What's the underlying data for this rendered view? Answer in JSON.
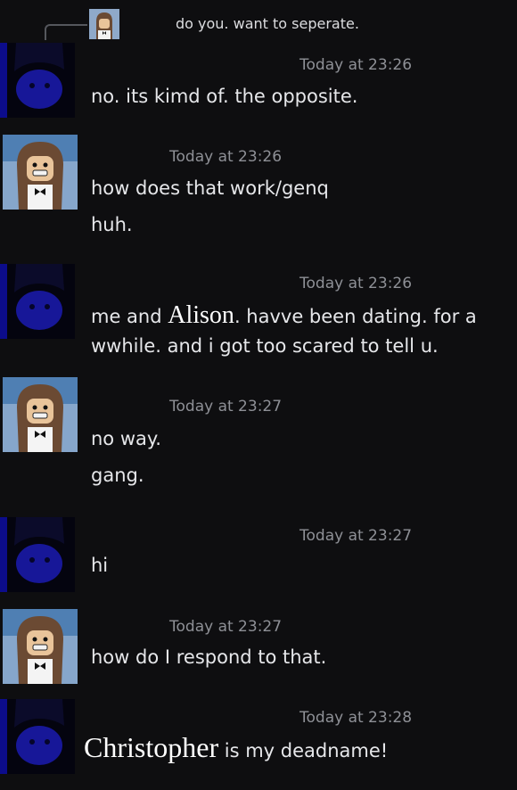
{
  "reply": {
    "text": "do you. want to seperate."
  },
  "messages": [
    {
      "avatar": "dark-blue-avatar",
      "timestamp": "Today at 23:26",
      "lines": [
        {
          "text": "no. its kimd of. the opposite."
        }
      ]
    },
    {
      "avatar": "roblox-girl-avatar",
      "timestamp": "Today at 23:26",
      "lines": [
        {
          "text": "how does that work/genq"
        },
        {
          "text": "huh."
        }
      ]
    },
    {
      "avatar": "dark-blue-avatar",
      "timestamp": "Today at 23:26",
      "lines": [
        {
          "before": "me and ",
          "overlay": "Alison",
          "after": ". havve been dating. for a"
        },
        {
          "text": "wwhile. and i got too scared to tell u."
        }
      ]
    },
    {
      "avatar": "roblox-girl-avatar",
      "timestamp": "Today at 23:27",
      "lines": [
        {
          "text": "no way."
        },
        {
          "text": "gang."
        }
      ]
    },
    {
      "avatar": "dark-blue-avatar",
      "timestamp": "Today at 23:27",
      "lines": [
        {
          "text": "hi"
        }
      ]
    },
    {
      "avatar": "roblox-girl-avatar",
      "timestamp": "Today at 23:27",
      "lines": [
        {
          "text": "how do I respond to that."
        }
      ]
    },
    {
      "avatar": "dark-blue-avatar",
      "timestamp": "Today at 23:28",
      "lines": [
        {
          "overlay": "Christopher",
          "after": " is my deadname!"
        }
      ]
    }
  ]
}
